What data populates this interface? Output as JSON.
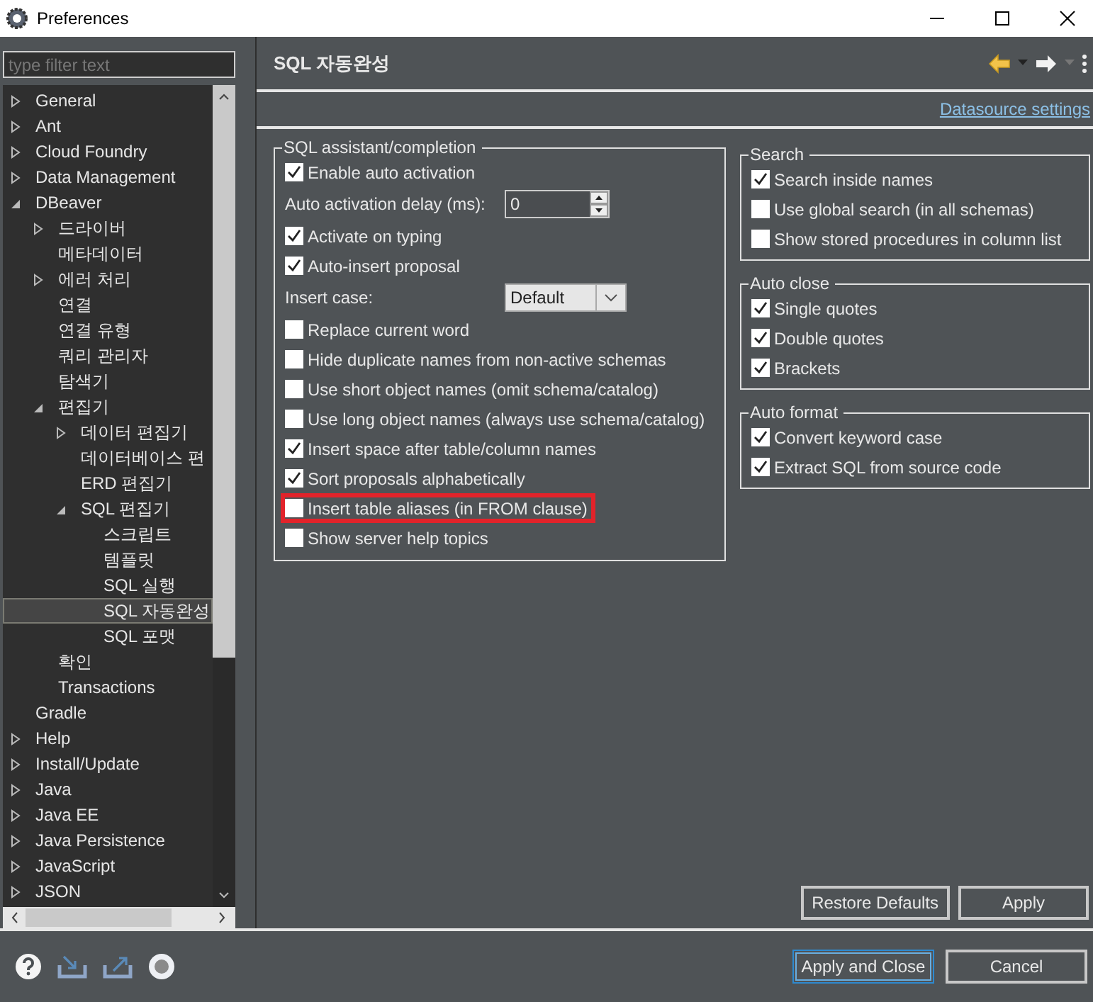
{
  "window": {
    "title": "Preferences"
  },
  "filter": {
    "placeholder": "type filter text"
  },
  "tree": [
    {
      "label": "General",
      "expanded": false,
      "selected": false
    },
    {
      "label": "Ant",
      "expanded": false,
      "selected": false
    },
    {
      "label": "Cloud Foundry",
      "expanded": false,
      "selected": false
    },
    {
      "label": "Data Management",
      "expanded": false,
      "selected": false
    },
    {
      "label": "DBeaver",
      "expanded": true,
      "selected": false,
      "children": [
        {
          "label": "드라이버",
          "expanded": false,
          "selected": false
        },
        {
          "label": "메타데이터",
          "selected": false
        },
        {
          "label": "에러 처리",
          "expanded": false,
          "selected": false
        },
        {
          "label": "연결",
          "selected": false
        },
        {
          "label": "연결 유형",
          "selected": false
        },
        {
          "label": "쿼리 관리자",
          "selected": false
        },
        {
          "label": "탐색기",
          "selected": false
        },
        {
          "label": "편집기",
          "expanded": true,
          "selected": false,
          "children": [
            {
              "label": "데이터 편집기",
              "expanded": false,
              "selected": false
            },
            {
              "label": "데이터베이스 편",
              "selected": false
            },
            {
              "label": "ERD 편집기",
              "selected": false
            },
            {
              "label": "SQL 편집기",
              "expanded": true,
              "selected": false,
              "children": [
                {
                  "label": "스크립트",
                  "selected": false
                },
                {
                  "label": "템플릿",
                  "selected": false
                },
                {
                  "label": "SQL 실행",
                  "selected": false
                },
                {
                  "label": "SQL 자동완성",
                  "selected": true
                },
                {
                  "label": "SQL 포맷",
                  "selected": false
                }
              ]
            }
          ]
        },
        {
          "label": "확인",
          "selected": false
        },
        {
          "label": "Transactions",
          "selected": false
        }
      ]
    },
    {
      "label": "Gradle",
      "selected": false
    },
    {
      "label": "Help",
      "expanded": false,
      "selected": false
    },
    {
      "label": "Install/Update",
      "expanded": false,
      "selected": false
    },
    {
      "label": "Java",
      "expanded": false,
      "selected": false
    },
    {
      "label": "Java EE",
      "expanded": false,
      "selected": false
    },
    {
      "label": "Java Persistence",
      "expanded": false,
      "selected": false
    },
    {
      "label": "JavaScript",
      "expanded": false,
      "selected": false
    },
    {
      "label": "JSON",
      "expanded": false,
      "selected": false
    }
  ],
  "page": {
    "title": "SQL 자동완성",
    "link": "Datasource settings"
  },
  "assistant": {
    "title": "SQL assistant/completion",
    "items": [
      {
        "kind": "checkbox",
        "label": "Enable auto activation",
        "checked": true,
        "highlighted": false
      },
      {
        "kind": "spinner",
        "label": "Auto activation delay (ms):",
        "value": "0"
      },
      {
        "kind": "checkbox",
        "label": "Activate on typing",
        "checked": true,
        "highlighted": false
      },
      {
        "kind": "checkbox",
        "label": "Auto-insert proposal",
        "checked": true,
        "highlighted": false
      },
      {
        "kind": "combo",
        "label": "Insert case:",
        "value": "Default"
      },
      {
        "kind": "checkbox",
        "label": "Replace current word",
        "checked": false,
        "highlighted": false
      },
      {
        "kind": "checkbox",
        "label": "Hide duplicate names from non-active schemas",
        "checked": false,
        "highlighted": false
      },
      {
        "kind": "checkbox",
        "label": "Use short object names (omit schema/catalog)",
        "checked": false,
        "highlighted": false
      },
      {
        "kind": "checkbox",
        "label": "Use long object names (always use schema/catalog)",
        "checked": false,
        "highlighted": false
      },
      {
        "kind": "checkbox",
        "label": "Insert space after table/column names",
        "checked": true,
        "highlighted": false
      },
      {
        "kind": "checkbox",
        "label": "Sort proposals alphabetically",
        "checked": true,
        "highlighted": false
      },
      {
        "kind": "checkbox",
        "label": "Insert table aliases (in FROM clause)",
        "checked": false,
        "highlighted": true
      },
      {
        "kind": "checkbox",
        "label": "Show server help topics",
        "checked": false,
        "highlighted": false
      }
    ]
  },
  "side_groups": [
    {
      "title": "Search",
      "items": [
        {
          "label": "Search inside names",
          "checked": true
        },
        {
          "label": "Use global search (in all schemas)",
          "checked": false
        },
        {
          "label": "Show stored procedures in column list",
          "checked": false
        }
      ]
    },
    {
      "title": "Auto close",
      "items": [
        {
          "label": "Single quotes",
          "checked": true
        },
        {
          "label": "Double quotes",
          "checked": true
        },
        {
          "label": "Brackets",
          "checked": true
        }
      ]
    },
    {
      "title": "Auto format",
      "items": [
        {
          "label": "Convert keyword case",
          "checked": true
        },
        {
          "label": "Extract SQL from source code",
          "checked": true
        }
      ]
    }
  ],
  "page_buttons": [
    {
      "label": "Restore Defaults"
    },
    {
      "label": "Apply"
    }
  ],
  "dialog_buttons": [
    {
      "label": "Apply and Close",
      "focused": true
    },
    {
      "label": "Cancel",
      "focused": false
    }
  ]
}
